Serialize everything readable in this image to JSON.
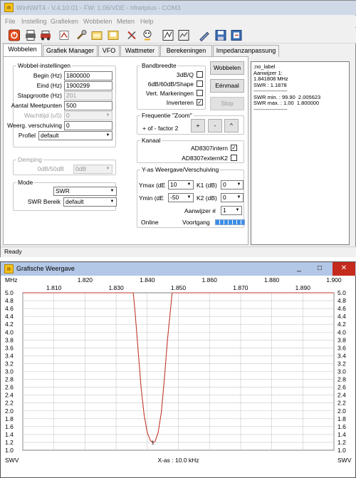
{
  "main_window": {
    "title": "WinNWT4 - V.4.10.01 - FW: 1.06/VDE - hfnetplus - COM3",
    "menu": [
      "File",
      "Instelling",
      "Grafieken",
      "Wobbelen",
      "Meten",
      "Help"
    ],
    "toolbar_icons": [
      "stop-icon",
      "printer-icon",
      "print-preview-icon",
      "car-icon",
      "tools-icon",
      "open-folder-icon",
      "save-icon",
      "cut-icon",
      "help-icon",
      "grid-icon",
      "zoom-icon",
      "pen-icon",
      "disk-icon",
      "export-icon"
    ],
    "tabs": [
      "Wobbelen",
      "Grafiek Manager",
      "VFO",
      "Wattmeter",
      "Berekeningen",
      "Impedanzanpassung"
    ],
    "status": "Ready"
  },
  "wobbel_settings": {
    "legend": "Wobbel-instellingen",
    "begin_label": "Begin (Hz)",
    "begin_value": "1800000",
    "eind_label": "Eind (Hz)",
    "eind_value": "1900299",
    "stap_label": "Stapgrootte (Hz)",
    "stap_value": "201",
    "aantal_label": "Aantal Meetpunten",
    "aantal_value": "500",
    "wacht_label": "Wachttijd (uS)",
    "wacht_value": "0",
    "weerg_label": "Weerg. verschuiving",
    "weerg_value": "0",
    "profiel_label": "Profiel",
    "profiel_value": "default"
  },
  "demping": {
    "legend": "Demping",
    "label": "0dB/50dB",
    "value": "0dB"
  },
  "mode": {
    "legend": "Mode",
    "mode_value": "SWR",
    "bereik_label": "SWR Bereik",
    "bereik_value": "default"
  },
  "bandbreedte": {
    "legend": "Bandbreedte",
    "opt1": "3dB/Q",
    "opt2": "6dB/60dB/Shape",
    "opt3": "Vert. Markeringen",
    "opt4": "Inverteren",
    "checked": [
      false,
      false,
      false,
      true
    ]
  },
  "buttons": {
    "wobbelen": "Wobbelen",
    "eenmaal": "Eénmaal",
    "stop": "Stop"
  },
  "zoom": {
    "legend": "Frequentie \"Zoom\"",
    "label": "+ of - factor 2",
    "plus": "+",
    "minus": "-",
    "caret": "^"
  },
  "kanaal": {
    "legend": "Kanaal",
    "opt1": "AD8307intern",
    "opt2": "AD8307externK2",
    "checked": [
      true,
      false
    ]
  },
  "yas": {
    "legend": "Y-as  Weergave/Verschuiving",
    "ymax_label": "Ymax (dE",
    "ymax_value": "10",
    "ymin_label": "Ymin  (dE",
    "ymin_value": "-50",
    "k1_label": "K1 (dB)",
    "k1_value": "0",
    "k2_label": "K2 (dB)",
    "k2_value": "0",
    "aanwijzer_label": "Aanwijzer #",
    "aanwijzer_value": "1",
    "online": "Online",
    "voortgang": "Voortgang"
  },
  "info_panel": {
    "lines": [
      ";no_label",
      "",
      "Aanwijzer 1:",
      "1.841808 MHz",
      "SWR : 1.1878",
      "-------------------",
      "SWR min. : 99.90  2.005623",
      "SWR max. : 1.00  1.800000",
      "-------------------"
    ]
  },
  "graph_window": {
    "title": "Grafische Weergave",
    "controls": [
      "_",
      "□",
      "✕"
    ],
    "left_unit": "MHz",
    "bottom_left": "SWV",
    "bottom_right": "SWV",
    "x_axis_label": "X-as : 10.0 kHz",
    "marker_label": "1"
  },
  "chart_data": {
    "type": "line",
    "x_ticks_top": [
      "1.820",
      "1.840",
      "1.860",
      "1.880",
      "1.900"
    ],
    "x_ticks_bottom": [
      "1.810",
      "1.830",
      "1.850",
      "1.870",
      "1.890"
    ],
    "xlim": [
      1.8,
      1.9
    ],
    "ylim": [
      1.0,
      5.0
    ],
    "y_ticks": [
      "5.0",
      "4.8",
      "4.6",
      "4.4",
      "4.2",
      "4.0",
      "3.8",
      "3.6",
      "3.4",
      "3.2",
      "3.0",
      "2.8",
      "2.6",
      "2.4",
      "2.2",
      "2.0",
      "1.8",
      "1.6",
      "1.4",
      "1.2",
      "1.0"
    ],
    "grid": true,
    "series": [
      {
        "color": "#c0392b",
        "x": [
          1.8,
          1.8355,
          1.836,
          1.837,
          1.838,
          1.839,
          1.84,
          1.841,
          1.8418,
          1.8425,
          1.8435,
          1.8445,
          1.8455,
          1.8465,
          1.8475,
          1.848,
          1.9
        ],
        "y": [
          5.0,
          5.0,
          4.6,
          3.6,
          2.6,
          1.9,
          1.45,
          1.25,
          1.19,
          1.22,
          1.45,
          1.95,
          2.8,
          3.8,
          4.6,
          5.0,
          5.0
        ]
      }
    ]
  }
}
